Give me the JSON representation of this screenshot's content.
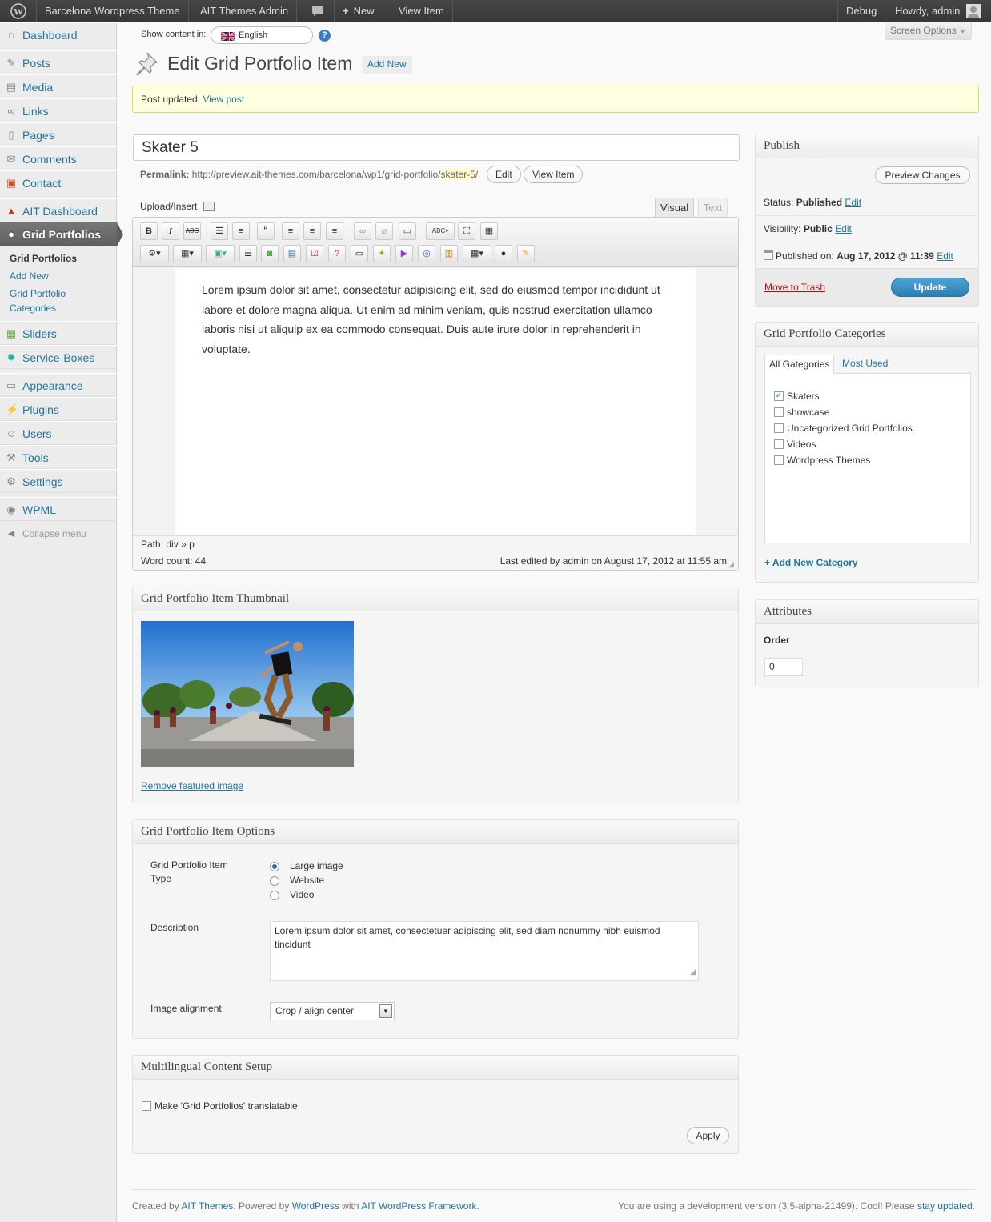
{
  "adminbar": {
    "site": "Barcelona Wordpress Theme",
    "themes_admin": "AIT Themes Admin",
    "new": "New",
    "view_item": "View Item",
    "debug": "Debug",
    "howdy": "Howdy, admin"
  },
  "sidebar": {
    "items": [
      {
        "label": "Dashboard"
      },
      {
        "label": "Posts"
      },
      {
        "label": "Media"
      },
      {
        "label": "Links"
      },
      {
        "label": "Pages"
      },
      {
        "label": "Comments"
      },
      {
        "label": "Contact"
      },
      {
        "label": "AIT Dashboard"
      },
      {
        "label": "Grid Portfolios"
      },
      {
        "label": "Sliders"
      },
      {
        "label": "Service-Boxes"
      },
      {
        "label": "Appearance"
      },
      {
        "label": "Plugins"
      },
      {
        "label": "Users"
      },
      {
        "label": "Tools"
      },
      {
        "label": "Settings"
      },
      {
        "label": "WPML"
      },
      {
        "label": "Collapse menu"
      }
    ],
    "sub": {
      "a": "Grid Portfolios",
      "b": "Add New",
      "c1": "Grid Portfolio",
      "c2": "Categories"
    }
  },
  "header": {
    "show_content_in": "Show content in:",
    "language": "English",
    "screen_options": "Screen Options",
    "title": "Edit Grid Portfolio Item",
    "add_new": "Add New"
  },
  "notice": {
    "text": "Post updated.",
    "link": "View post"
  },
  "post": {
    "title": "Skater 5",
    "permalink_label": "Permalink:",
    "permalink_base": "http://preview.ait-themes.com/barcelona/wp1/grid-portfolio/",
    "permalink_slug": "skater-5",
    "permalink_end": "/",
    "edit": "Edit",
    "view_item": "View Item"
  },
  "editor": {
    "upload_insert": "Upload/Insert",
    "tab_visual": "Visual",
    "tab_text": "Text",
    "content": "Lorem ipsum dolor sit amet, consectetur adipisicing elit, sed do eiusmod tempor incididunt ut labore et dolore magna aliqua. Ut enim ad minim veniam, quis nostrud exercitation ullamco laboris nisi ut aliquip ex ea commodo consequat. Duis aute irure dolor in reprehenderit in voluptate.",
    "path_label": "Path:",
    "path_div": "div",
    "path_sep": "»",
    "path_p": "p",
    "word_count": "Word count: 44",
    "last_edited": "Last edited by admin on August 17, 2012 at 11:55 am"
  },
  "thumbnail": {
    "title": "Grid Portfolio Item Thumbnail",
    "remove": "Remove featured image"
  },
  "options": {
    "title": "Grid Portfolio Item Options",
    "type_label1": "Grid Portfolio Item",
    "type_label2": "Type",
    "types": [
      "Large image",
      "Website",
      "Video"
    ],
    "desc_label": "Description",
    "desc_value": "Lorem ipsum dolor sit amet, consectetuer adipiscing elit, sed diam nonummy nibh euismod tincidunt",
    "align_label": "Image alignment",
    "align_value": "Crop / align center"
  },
  "multilingual": {
    "title": "Multilingual Content Setup",
    "checkbox": "Make 'Grid Portfolios' translatable",
    "apply": "Apply"
  },
  "publish": {
    "title": "Publish",
    "preview": "Preview Changes",
    "status_label": "Status:",
    "status": "Published",
    "visibility_label": "Visibility:",
    "visibility": "Public",
    "published_label": "Published on:",
    "published": "Aug 17, 2012 @ 11:39",
    "edit": "Edit",
    "trash": "Move to Trash",
    "update": "Update"
  },
  "categories": {
    "title": "Grid Portfolio Categories",
    "tab_all": "All Gategories",
    "tab_used": "Most Used",
    "items": [
      {
        "label": "Skaters",
        "checked": true
      },
      {
        "label": "showcase",
        "checked": false
      },
      {
        "label": "Uncategorized Grid Portfolios",
        "checked": false
      },
      {
        "label": "Videos",
        "checked": false
      },
      {
        "label": "Wordpress Themes",
        "checked": false
      }
    ],
    "add": "+ Add New Category"
  },
  "attributes": {
    "title": "Attributes",
    "order_label": "Order",
    "order_value": "0"
  },
  "footer": {
    "created_by": "Created by",
    "ait": "AIT Themes",
    "powered": ". Powered by",
    "wordpress": "WordPress",
    "with": "with",
    "framework": "AIT WordPress Framework",
    "dot": ".",
    "dev_text": "You are using a development version (3.5-alpha-21499). Cool! Please",
    "stay": "stay updated",
    "end": "."
  },
  "colors": {
    "link": "#21759b",
    "update_btn": "#2e8cc2",
    "notice_bg": "#ffffe0"
  }
}
